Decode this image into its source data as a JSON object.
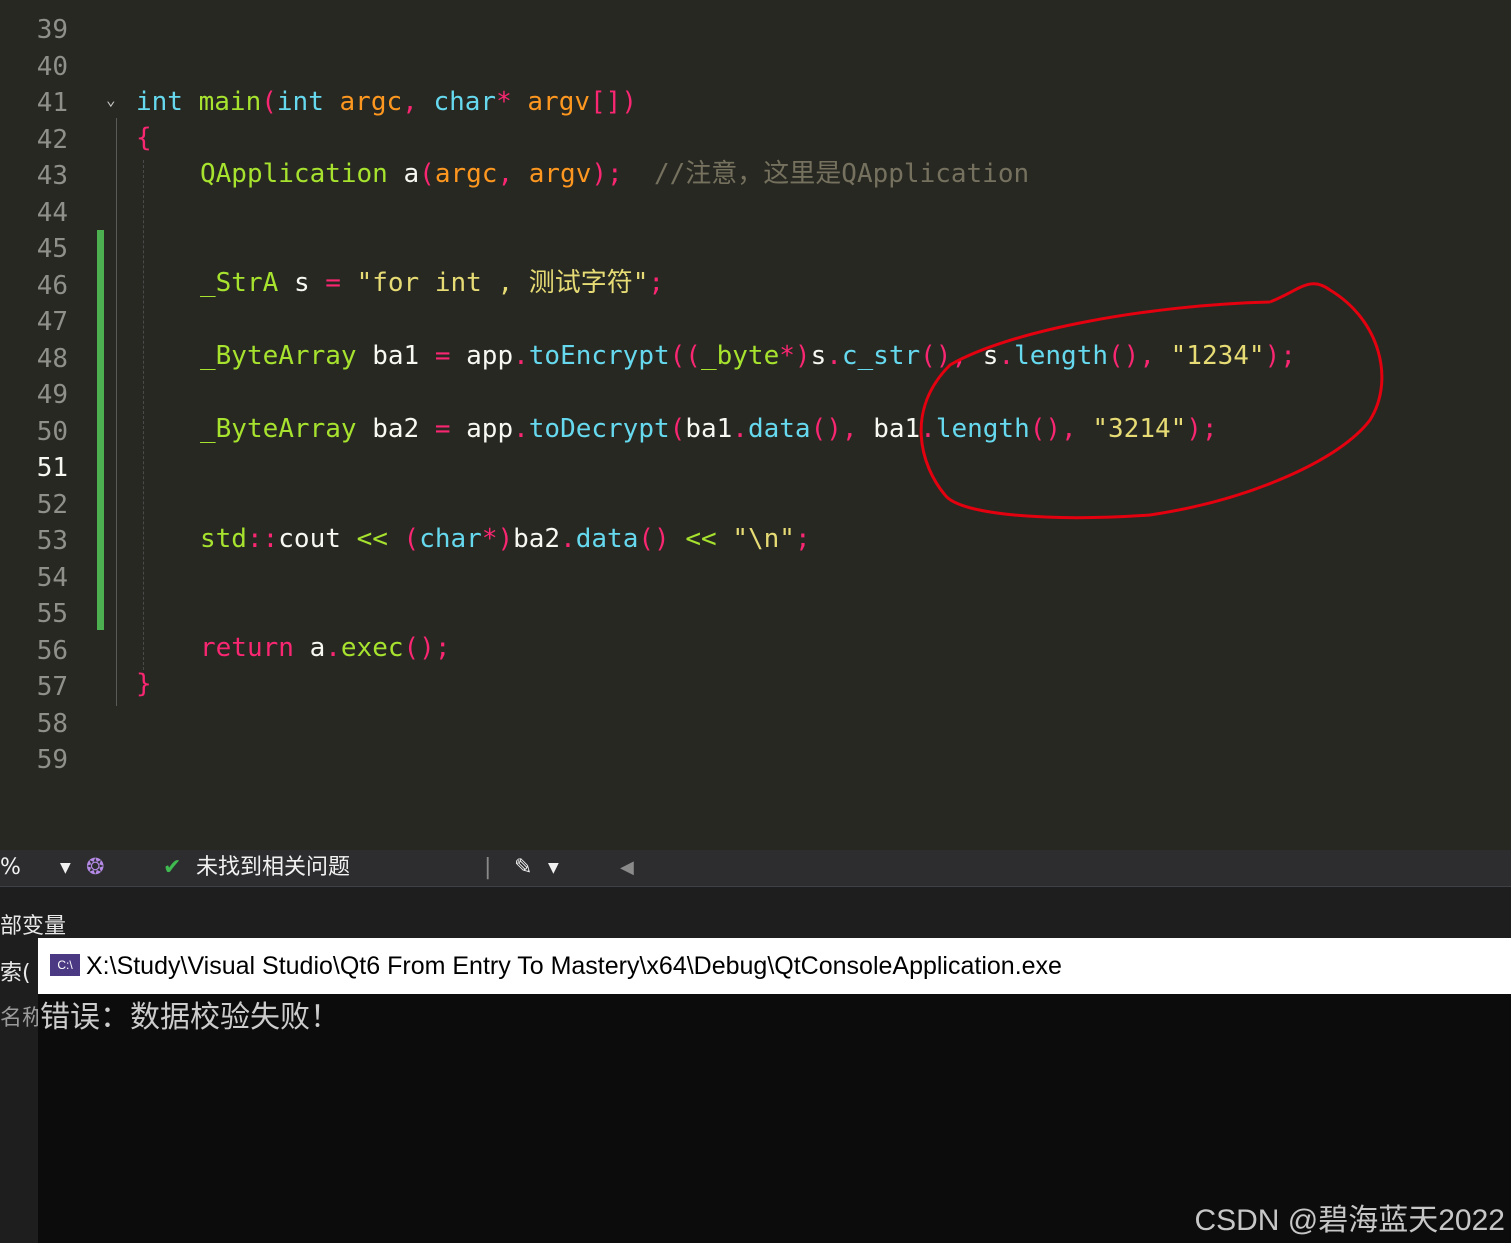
{
  "editor": {
    "line_numbers": [
      "39",
      "40",
      "41",
      "42",
      "43",
      "44",
      "45",
      "46",
      "47",
      "48",
      "49",
      "50",
      "51",
      "52",
      "53",
      "54",
      "55",
      "56",
      "57",
      "58",
      "59"
    ],
    "current_line": "51",
    "code": {
      "l41": {
        "t1": "int",
        "t2": "main",
        "t3": "(",
        "t4": "int",
        "t5": "argc",
        ",": ",",
        "t6": "char",
        "t7": "*",
        "t8": "argv",
        "t9": "[])"
      },
      "l42": "{",
      "l43": {
        "cls": "QApplication",
        "var": "a",
        "p1": "(",
        "a1": "argc",
        "comma": ",",
        "a2": "argv",
        "p2": ");",
        "cmt": "//注意，这里是QApplication"
      },
      "l46": {
        "cls": "_StrA",
        "var": "s",
        "eq": "=",
        "str": "\"for int , 测试字符\"",
        "semi": ";"
      },
      "l48": {
        "cls": "_ByteArray",
        "var": "ba1",
        "eq": "=",
        "obj": "app",
        "dot": ".",
        "fn": "toEncrypt",
        "p1": "((",
        "kw": "_byte",
        "star": "*)",
        "v2": "s",
        "d2": ".",
        "fn2": "c_str",
        "p2": "(),",
        "v3": "s",
        "d3": ".",
        "fn3": "length",
        "p3": "(),",
        "str": "\"1234\"",
        "end": ");"
      },
      "l50": {
        "cls": "_ByteArray",
        "var": "ba2",
        "eq": "=",
        "obj": "app",
        "dot": ".",
        "fn": "toDecrypt",
        "p1": "(",
        "v2": "ba1",
        "d2": ".",
        "fn2": "data",
        "p2": "(),",
        "v3": "ba1",
        "d3": ".",
        "fn3": "length",
        "p3": "(),",
        "str": "\"3214\"",
        "end": ");"
      },
      "l53": {
        "ns": "std",
        "sep": "::",
        "obj": "cout",
        "op": "<<",
        "p1": "(",
        "kw": "char",
        "star": "*)",
        "v": "ba2",
        "dot": ".",
        "fn": "data",
        "p2": "()",
        "op2": "<<",
        "str": "\"\\n\"",
        "semi": ";"
      },
      "l56": {
        "kw": "return",
        "v": "a",
        "dot": ".",
        "fn": "exec",
        "end": "();"
      },
      "l57": "}"
    }
  },
  "statusbar": {
    "zoom": "%",
    "issues": "未找到相关问题"
  },
  "panel": {
    "title": "部变量",
    "side_1": "索(",
    "side_2": "名称"
  },
  "console": {
    "title": "X:\\Study\\Visual Studio\\Qt6 From Entry To Mastery\\x64\\Debug\\QtConsoleApplication.exe",
    "icon_label": "C:\\",
    "output": "错误：数据校验失败！"
  },
  "watermark": "CSDN @碧海蓝天2022",
  "colors": {
    "annotation": "#e3000f",
    "change_bar": "#4caf50"
  }
}
